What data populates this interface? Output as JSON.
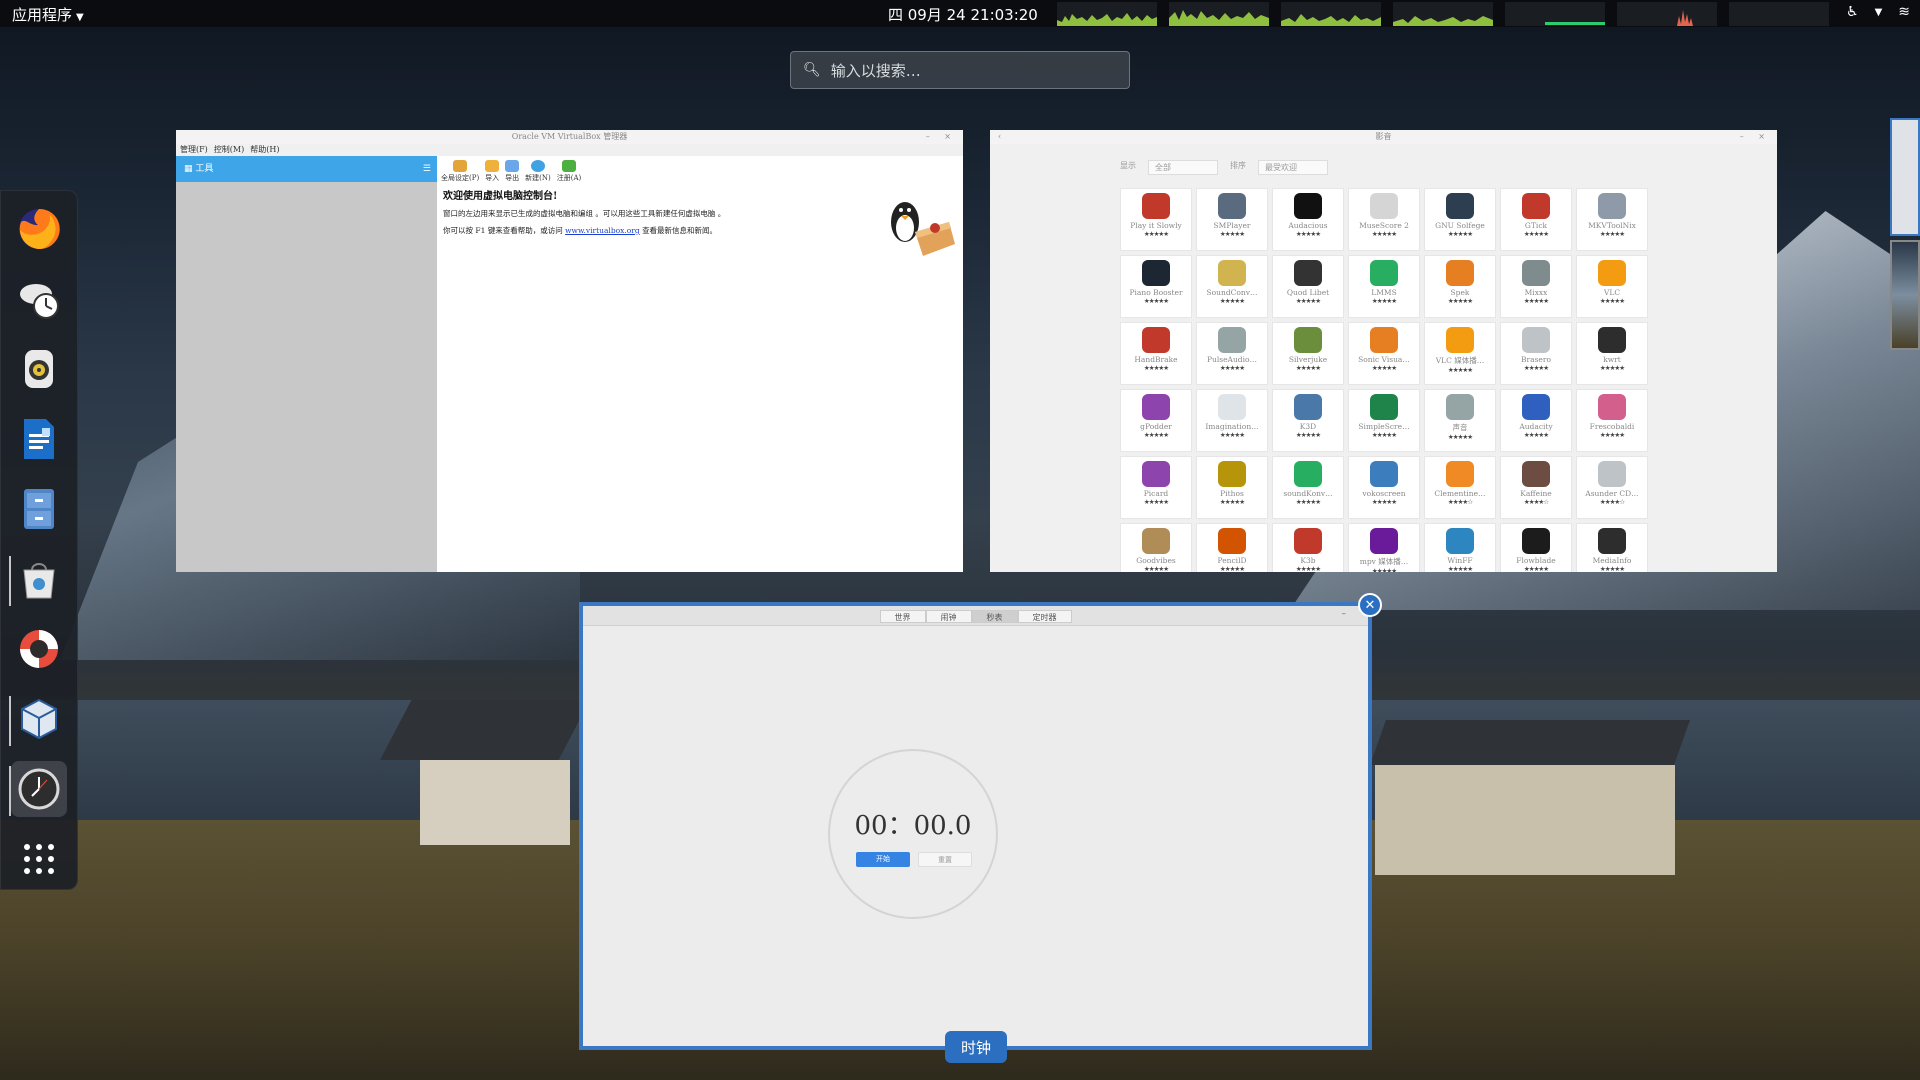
{
  "topbar": {
    "apps_label": "应用程序",
    "datetime": "四 09月 24  21:03:20"
  },
  "search": {
    "placeholder": "输入以搜索…"
  },
  "dash": {
    "items": [
      {
        "name": "firefox-icon"
      },
      {
        "name": "timeshift-icon"
      },
      {
        "name": "speaker-icon"
      },
      {
        "name": "writer-icon"
      },
      {
        "name": "file-cabinet-icon"
      },
      {
        "name": "software-store-icon"
      },
      {
        "name": "help-icon"
      },
      {
        "name": "virtualbox-icon"
      },
      {
        "name": "clock-icon"
      },
      {
        "name": "show-apps-icon"
      }
    ]
  },
  "virtualbox": {
    "title": "Oracle VM VirtualBox 管理器",
    "menus": [
      "管理(F)",
      "控制(M)",
      "帮助(H)"
    ],
    "tools_label": "工具",
    "toolbar": [
      "全局设定(P)",
      "导入",
      "导出",
      "新建(N)",
      "注册(A)"
    ],
    "welcome_title": "欢迎使用虚拟电脑控制台!",
    "welcome_line1": "窗口的左边用来显示已生成的虚拟电脑和编组 。可以用这些工具新建任何虚拟电脑 。",
    "welcome_line2_prefix": "你可以按 F1 键来查看帮助，或访问",
    "welcome_link": "www.virtualbox.org",
    "welcome_line2_suffix": "查看最新信息和新闻。"
  },
  "music": {
    "title": "影音",
    "show_label": "显示",
    "show_value": "全部",
    "sort_label": "排序",
    "sort_value": "最受欢迎",
    "apps": [
      {
        "name": "Play it Slowly",
        "stars": "★★★★★",
        "color": "#c0392b"
      },
      {
        "name": "SMPlayer",
        "stars": "★★★★★",
        "color": "#5a6b80"
      },
      {
        "name": "Audacious",
        "stars": "★★★★★",
        "color": "#111111"
      },
      {
        "name": "MuseScore 2",
        "stars": "★★★★★",
        "color": "#d5d5d5"
      },
      {
        "name": "GNU Solfege",
        "stars": "★★★★★",
        "color": "#2c3e50"
      },
      {
        "name": "GTick",
        "stars": "★★★★★",
        "color": "#c0392b"
      },
      {
        "name": "MKVToolNix",
        "stars": "★★★★★",
        "color": "#8e9aa8"
      },
      {
        "name": "Piano Booster",
        "stars": "★★★★★",
        "color": "#1d2733"
      },
      {
        "name": "SoundConv…",
        "stars": "★★★★★",
        "color": "#d1b450"
      },
      {
        "name": "Quod Libet",
        "stars": "★★★★★",
        "color": "#333333"
      },
      {
        "name": "LMMS",
        "stars": "★★★★★",
        "color": "#27ae60"
      },
      {
        "name": "Spek",
        "stars": "★★★★★",
        "color": "#e67e22"
      },
      {
        "name": "Mixxx",
        "stars": "★★★★★",
        "color": "#7f8c8d"
      },
      {
        "name": "VLC",
        "stars": "★★★★★",
        "color": "#f39c12"
      },
      {
        "name": "HandBrake",
        "stars": "★★★★★",
        "color": "#c0392b"
      },
      {
        "name": "PulseAudio…",
        "stars": "★★★★★",
        "color": "#95a5a6"
      },
      {
        "name": "Silverjuke",
        "stars": "★★★★★",
        "color": "#6b8e3d"
      },
      {
        "name": "Sonic Visua…",
        "stars": "★★★★★",
        "color": "#e67e22"
      },
      {
        "name": "VLC 媒体播…",
        "stars": "★★★★★",
        "color": "#f39c12"
      },
      {
        "name": "Brasero",
        "stars": "★★★★★",
        "color": "#bdc3c7"
      },
      {
        "name": "kwrt",
        "stars": "★★★★★",
        "color": "#2d2d2d"
      },
      {
        "name": "gPodder",
        "stars": "★★★★★",
        "color": "#8e44ad"
      },
      {
        "name": "Imagination…",
        "stars": "★★★★★",
        "color": "#dfe4e8"
      },
      {
        "name": "K3D",
        "stars": "★★★★★",
        "color": "#4a78a8"
      },
      {
        "name": "SimpleScre…",
        "stars": "★★★★★",
        "color": "#1e8449"
      },
      {
        "name": "声音",
        "stars": "★★★★★",
        "color": "#95a5a6"
      },
      {
        "name": "Audacity",
        "stars": "★★★★★",
        "color": "#2f5fbf"
      },
      {
        "name": "Frescobaldi",
        "stars": "★★★★★",
        "color": "#d35f8d"
      },
      {
        "name": "Picard",
        "stars": "★★★★★",
        "color": "#8e44ad"
      },
      {
        "name": "Pithos",
        "stars": "★★★★★",
        "color": "#b7950b"
      },
      {
        "name": "soundKonv…",
        "stars": "★★★★★",
        "color": "#27ae60"
      },
      {
        "name": "vokoscreen",
        "stars": "★★★★★",
        "color": "#3c7dbd"
      },
      {
        "name": "Clementine…",
        "stars": "★★★★☆",
        "color": "#f08a24"
      },
      {
        "name": "Kaffeine",
        "stars": "★★★★☆",
        "color": "#6d4c41"
      },
      {
        "name": "Asunder CD…",
        "stars": "★★★★☆",
        "color": "#bdc3c7"
      },
      {
        "name": "Goodvibes",
        "stars": "★★★★★",
        "color": "#b08d57"
      },
      {
        "name": "PencilD",
        "stars": "★★★★★",
        "color": "#d35400"
      },
      {
        "name": "K3b",
        "stars": "★★★★★",
        "color": "#c0392b"
      },
      {
        "name": "mpv 媒体播…",
        "stars": "★★★★★",
        "color": "#6a1b9a"
      },
      {
        "name": "WinFF",
        "stars": "★★★★★",
        "color": "#2e86c1"
      },
      {
        "name": "Flowblade",
        "stars": "★★★★★",
        "color": "#1c1c1c"
      },
      {
        "name": "MediaInfo",
        "stars": "★★★★★",
        "color": "#2d2d2d"
      }
    ]
  },
  "clock": {
    "tabs": [
      "世界",
      "闹钟",
      "秒表",
      "定时器"
    ],
    "selected_tab": "秒表",
    "time": "00：00.0",
    "start_label": "开始",
    "reset_label": "重置",
    "window_label": "时钟"
  },
  "colors": {
    "accent": "#3584e4",
    "topbar": "#0a0c0f",
    "highlight_border": "#3b78c4"
  }
}
